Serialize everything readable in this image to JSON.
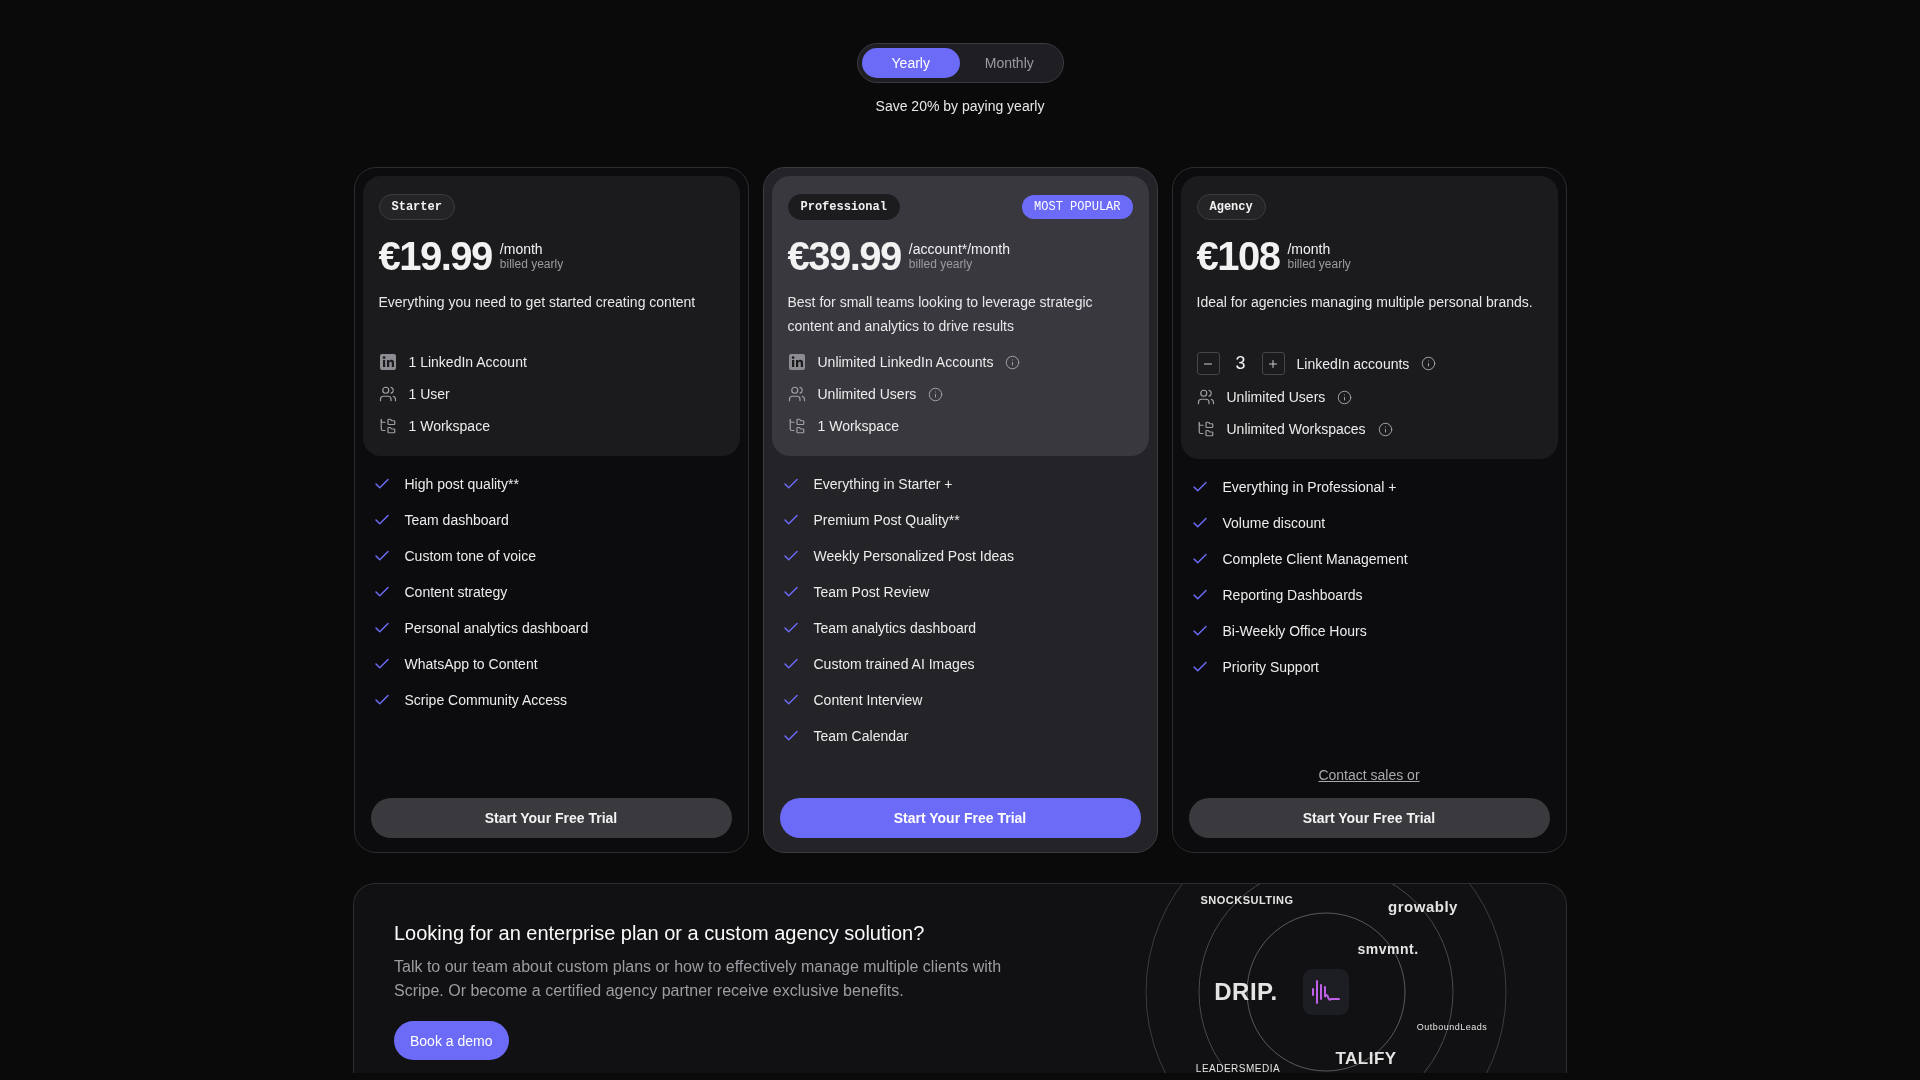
{
  "billing_toggle": {
    "options": [
      {
        "label": "Yearly",
        "selected": true
      },
      {
        "label": "Monthly",
        "selected": false
      }
    ],
    "note": "Save 20% by paying yearly"
  },
  "plans": [
    {
      "tag": "Starter",
      "featured": false,
      "price": "€19.99",
      "period": "/month",
      "billing": "billed yearly",
      "description": "Everything you need to get started creating content",
      "limits": [
        {
          "kind": "linkedin",
          "text": "1 LinkedIn Account",
          "info": false
        },
        {
          "kind": "users",
          "text": "1 User",
          "info": false
        },
        {
          "kind": "workspace",
          "text": "1 Workspace",
          "info": false
        }
      ],
      "features": [
        "High post quality**",
        "Team dashboard",
        "Custom tone of voice",
        "Content strategy",
        "Personal analytics dashboard",
        "WhatsApp to Content",
        "Scripe Community Access"
      ],
      "cta": "Start Your Free Trial"
    },
    {
      "tag": "Professional",
      "featured": true,
      "badge": "MOST POPULAR",
      "price": "€39.99",
      "period": "/account*/month",
      "billing": "billed yearly",
      "description": "Best for small teams looking to leverage strategic content and analytics to drive results",
      "limits": [
        {
          "kind": "linkedin",
          "text": "Unlimited LinkedIn Accounts",
          "info": true
        },
        {
          "kind": "users",
          "text": "Unlimited Users",
          "info": true
        },
        {
          "kind": "workspace",
          "text": "1 Workspace",
          "info": false
        }
      ],
      "features": [
        "Everything in Starter +",
        "Premium Post Quality**",
        "Weekly Personalized Post Ideas",
        "Team Post Review",
        "Team analytics dashboard",
        "Custom trained AI Images",
        "Content Interview",
        "Team Calendar"
      ],
      "cta": "Start Your Free Trial"
    },
    {
      "tag": "Agency",
      "featured": false,
      "price": "€108",
      "period": "/month",
      "billing": "billed yearly",
      "description": "Ideal for agencies managing multiple personal brands.",
      "limits": [
        {
          "kind": "stepper",
          "value": "3",
          "text": "LinkedIn accounts",
          "info": true
        },
        {
          "kind": "users",
          "text": "Unlimited Users",
          "info": true
        },
        {
          "kind": "workspace",
          "text": "Unlimited Workspaces",
          "info": true
        }
      ],
      "features": [
        "Everything in Professional +",
        "Volume discount",
        "Complete Client Management",
        "Reporting Dashboards",
        "Bi-Weekly Office Hours",
        "Priority Support"
      ],
      "contact_link": "Contact sales or",
      "cta": "Start Your Free Trial"
    }
  ],
  "enterprise": {
    "title": "Looking for an enterprise plan or a custom agency solution?",
    "text": "Talk to our team about custom plans or how to effectively manage multiple clients with Scripe. Or become a certified agency partner receive exclusive benefits.",
    "button": "Book a demo",
    "partner_logos": [
      "SNOCKSULTING",
      "growably",
      "smvmnt.",
      "DRIP.",
      "OutboundLeads",
      "TALIFY",
      "LEADERSMEDIA"
    ]
  }
}
